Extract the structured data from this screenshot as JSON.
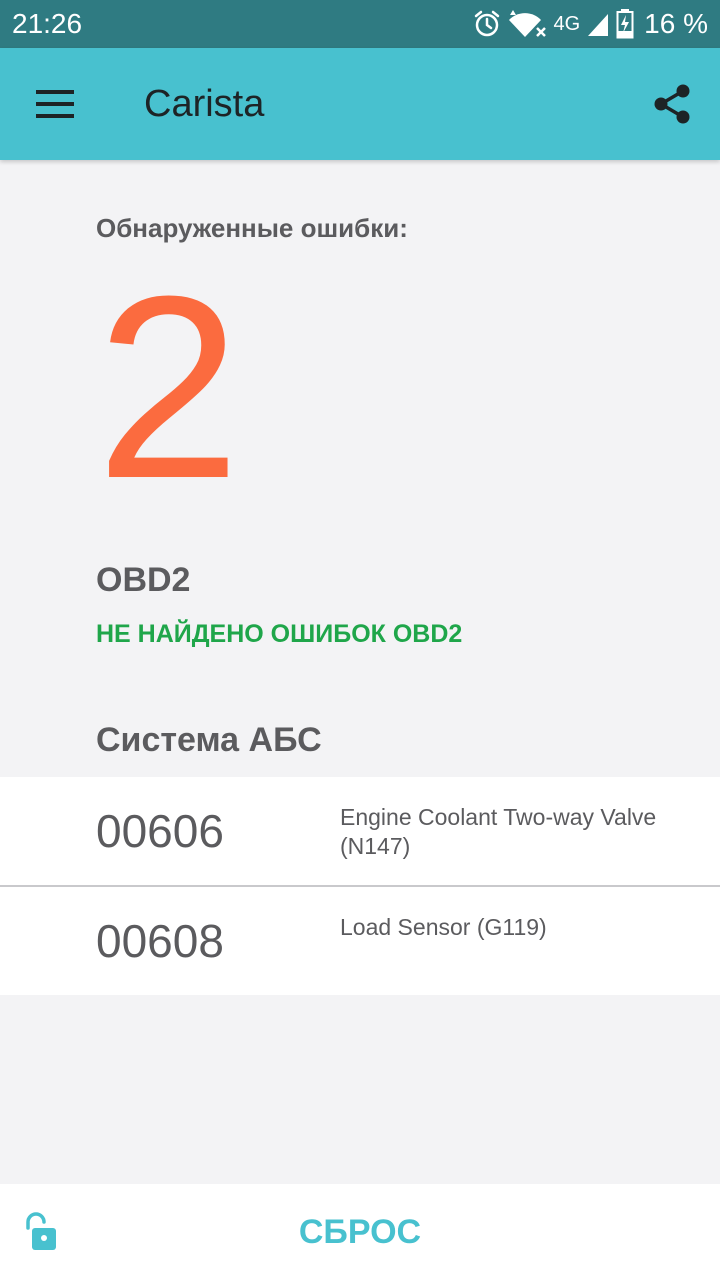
{
  "status_bar": {
    "time": "21:26",
    "network": "4G",
    "battery_percent": "16 %",
    "icons": [
      "alarm-icon",
      "wifi-icon",
      "signal-icon",
      "battery-charging-icon"
    ]
  },
  "app_bar": {
    "title": "Carista",
    "icons": [
      "menu-icon",
      "share-icon"
    ],
    "background_color": "#48c1cf"
  },
  "summary": {
    "errors_label": "Обнаруженные ошибки:",
    "errors_count": "2",
    "count_color": "#fb6b3f"
  },
  "obd2": {
    "title": "OBD2",
    "status": "НЕ НАЙДЕНО ОШИБОК OBD2",
    "status_color": "#1fa64a"
  },
  "abs": {
    "title": "Система АБС",
    "faults": [
      {
        "code": "00606",
        "description": "Engine Coolant Two-way Valve (N147)"
      },
      {
        "code": "00608",
        "description": "Load Sensor (G119)"
      }
    ]
  },
  "bottom_bar": {
    "reset_label": "СБРОС",
    "lock_icon": "unlock-icon",
    "accent_color": "#48c1cf"
  }
}
